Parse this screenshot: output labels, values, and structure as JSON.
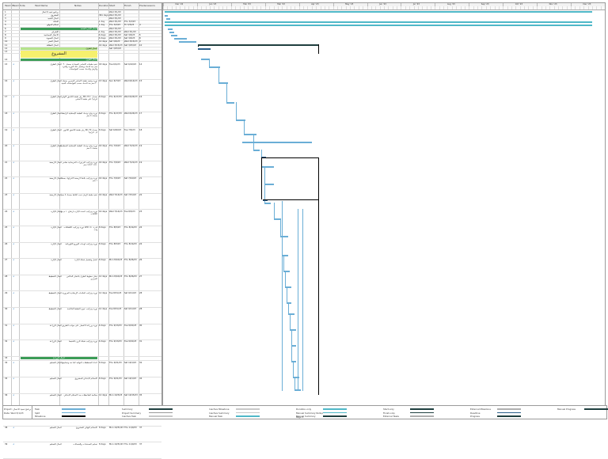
{
  "columns": {
    "num": "Task ID",
    "mode": "Task Mode",
    "name": "Task Name",
    "notes": "Notes",
    "duration": "Duration",
    "start": "Start",
    "finish": "Finish",
    "pred": "Predecessors"
  },
  "timeline": {
    "months": [
      "Dec '22",
      "Jan '23",
      "Feb '23",
      "Mar '23",
      "Apr '23",
      "May '23",
      "Jun '23",
      "Jul '23",
      "Aug '23",
      "Sep '23",
      "Oct '23",
      "Nov '23",
      "Dec '23"
    ]
  },
  "rows": [
    {
      "id": "1",
      "mode": "",
      "name": "برنامج تنفيذ الاعمال",
      "dur": "",
      "start": "Wed 3/1/23",
      "finish": "",
      "pred": "",
      "style": "plain"
    },
    {
      "id": "2",
      "mode": "",
      "name": "المشروع",
      "dur": "361 days",
      "start": "Wed 3/1/23",
      "finish": "",
      "pred": "",
      "style": "plain"
    },
    {
      "id": "3",
      "mode": "",
      "name": "اعمال التنفيذ",
      "dur": "",
      "start": "Wed 3/1/23",
      "finish": "",
      "pred": "",
      "style": "plain"
    },
    {
      "id": "4",
      "mode": "",
      "name": "التعاقد",
      "dur": "1 day",
      "start": "Wed 3/1/23",
      "finish": "Thu 3/2/23",
      "pred": "",
      "style": "plain"
    },
    {
      "id": "5",
      "mode": "",
      "name": "استلام الموقع",
      "dur": "1 day",
      "start": "Thu 3/2/23",
      "finish": "Fri 3/3/23",
      "pred": "4",
      "style": "plain"
    },
    {
      "id": "6",
      "mode": "",
      "name": "أعمال الإدارة العامة",
      "dur": "",
      "start": "Wed 3/1/23",
      "finish": "",
      "pred": "",
      "style": "green"
    },
    {
      "id": "7",
      "mode": "",
      "name": "الإشراف",
      "dur": "1 day",
      "start": "Wed 3/1/23",
      "finish": "Wed 3/1/23",
      "pred": "",
      "style": "plain"
    },
    {
      "id": "8",
      "mode": "",
      "name": "الاعمال المساحية",
      "dur": "6 days",
      "start": "Wed 3/1/23",
      "finish": "Sat 3/4/23",
      "pred": "5",
      "style": "plain"
    },
    {
      "id": "9",
      "mode": "",
      "name": "أعمال التسوية",
      "dur": "6 days",
      "start": "Wed 3/1/23",
      "finish": "Sat 3/4/23",
      "pred": "8",
      "style": "plain"
    },
    {
      "id": "10",
      "mode": "",
      "name": "أعمال الحفر",
      "dur": "10 days",
      "start": "Sat 3/4/23",
      "finish": "Wed 3/15/23",
      "pred": "9",
      "style": "plain"
    },
    {
      "id": "11",
      "mode": "",
      "name": "اعمال النظافة",
      "dur": "16 days",
      "start": "Wed 3/15/23",
      "finish": "Sat 3/25/23",
      "pred": "10",
      "style": "plain"
    },
    {
      "id": "12",
      "mode": "",
      "name": "اعمال الطرق",
      "dur": "",
      "start": "Sat 3/25/23",
      "finish": "",
      "pred": "",
      "style": "lime"
    },
    {
      "id": "13",
      "mode": "",
      "name": "المشروع",
      "dur": "",
      "start": "",
      "finish": "",
      "pred": "",
      "style": "yellow"
    },
    {
      "id": "14",
      "mode": "",
      "name": "اعمال الطرق",
      "dur": "",
      "start": "",
      "finish": "",
      "pred": "",
      "style": "green"
    }
  ],
  "bigrows": [
    {
      "id": "15",
      "mode": "",
      "name": "اعمال الطرق",
      "notes": "تنفيذ طبقات الأساس المساعد بسمك ٣٠ سم بعد الدمك ويشمل ذلك التوريد والفرد والرش والدمك حسب المواصفات",
      "dur": "18 days",
      "start": "Tue 6/1/23",
      "finish": "Sat 6/10/23",
      "pred": "14"
    },
    {
      "id": "16",
      "mode": "",
      "name": "اعمال الطرق",
      "notes": "توريد وتنفيذ طبقة الأساس الحجري بسمك ٢٠ سم بعد الدمك حسب المواصفات الفنية",
      "dur": "13 days",
      "start": "Sun 6/7/23",
      "finish": "Wed 6/14/23",
      "pred": "15"
    },
    {
      "id": "17",
      "mode": "",
      "name": "اعمال الطرق",
      "notes": "رش طبقة اللاصق الأولي MC-70 بمعدل ١ لتر/م٢ على طبقة الأساس",
      "dur": "8 days",
      "start": "Thu 6/17/23",
      "finish": "Wed 6/24/23",
      "pred": "16"
    },
    {
      "id": "18",
      "mode": "",
      "name": "اعمال الطرق",
      "notes": "توريد وفرد ودمك الطبقة الإسفلتية الرابطة بسمك ٥ سم",
      "dur": "8 days",
      "start": "Thu 6/17/23",
      "finish": "Wed 6/24/23",
      "pred": "17"
    },
    {
      "id": "19",
      "mode": "",
      "name": "اعمال الطرق",
      "notes": "رش طبقة اللاصق الثانوي RC-70 بمعدل ٠٫٥ لتر/م٢",
      "dur": "8 days",
      "start": "Sat 6/26/23",
      "finish": "Tue 7/5/23",
      "pred": "18"
    },
    {
      "id": "20",
      "mode": "",
      "name": "اعمال الطرق",
      "notes": "توريد وفرد ودمك الطبقة الإسفلتية السطحية بسمك ٥ سم",
      "dur": "16 days",
      "start": "Thu 7/6/23",
      "finish": "Wed 7/21/23",
      "pred": "19"
    },
    {
      "id": "21",
      "mode": "",
      "name": "اعمال الأرصفة",
      "notes": "توريد وتركيب البردورات الخرسانية مقاس ٥٠×٣٠×١٥ سم",
      "dur": "16 days",
      "start": "Thu 7/6/23",
      "finish": "Wed 7/21/23",
      "pred": "19"
    },
    {
      "id": "22",
      "mode": "",
      "name": "اعمال الأرصفة",
      "notes": "توريد وتركيب بلاط الأرصفة الانترلوك بسمك ٦ سم",
      "dur": "16 days",
      "start": "Thu 7/6/23",
      "finish": "Sat 7/24/23",
      "pred": "21"
    },
    {
      "id": "23",
      "mode": "",
      "name": "اعمال الأرصفة",
      "notes": "تنفيذ طبقة الرمل تحت البلاط بسمك ٥ سم",
      "dur": "16 days",
      "start": "Wed 7/14/23",
      "finish": "Sat 7/31/23",
      "pred": "22"
    },
    {
      "id": "24",
      "mode": "",
      "name": "اعمال الإنارة",
      "notes": "توريد وتركيب أعمدة الإنارة بارتفاع ١٠ م مع الكابلات",
      "dur": "16 days",
      "start": "Wed 7/14/23",
      "finish": "Tue 8/3/23",
      "pred": "23"
    },
    {
      "id": "25",
      "mode": "",
      "name": "اعمال الإنارة",
      "notes": "توريد وتركيب الكشافات LED قدرة ١٥٠ وات",
      "dur": "8 days",
      "start": "Thu 8/5/23",
      "finish": "Thu 8/14/23",
      "pred": "24"
    },
    {
      "id": "26",
      "mode": "",
      "name": "اعمال الإنارة",
      "notes": "توريد وتركيب لوحات التوزيع الكهربائية",
      "dur": "8 days",
      "start": "Thu 8/5/23",
      "finish": "Thu 8/14/23",
      "pred": "24"
    },
    {
      "id": "27",
      "mode": "",
      "name": "اعمال الإنارة",
      "notes": "اختبار وتشغيل شبكة الإنارة",
      "dur": "8 days",
      "start": "Mon 8/16/23",
      "finish": "Thu 8/26/23",
      "pred": "26"
    },
    {
      "id": "28",
      "mode": "",
      "name": "اعمال التخطيط",
      "notes": "دهان خطوط الطرق بالدهان العاكس الحراري",
      "dur": "12 days",
      "start": "Mon 8/16/23",
      "finish": "Thu 8/26/23",
      "pred": "27"
    },
    {
      "id": "29",
      "mode": "",
      "name": "اعمال التخطيط",
      "notes": "توريد وتركيب العلامات الإرشادية المرورية",
      "dur": "12 days",
      "start": "Tue 8/31/23",
      "finish": "Sat 9/11/23",
      "pred": "28"
    },
    {
      "id": "30",
      "mode": "",
      "name": "اعمال التخطيط",
      "notes": "توريد وتركيب عيون القطط العاكسة",
      "dur": "12 days",
      "start": "Tue 8/31/23",
      "finish": "Sat 9/11/23",
      "pred": "28"
    },
    {
      "id": "31",
      "mode": "",
      "name": "اعمال الزراعة",
      "notes": "توريد وزراعة الأشجار على جوانب الطريق",
      "dur": "6 days",
      "start": "Thu 9/13/23",
      "finish": "Tue 9/19/23",
      "pred": "30"
    },
    {
      "id": "32",
      "mode": "",
      "name": "اعمال الزراعة",
      "notes": "توريد وتركيب شبكة الري بالتنقيط",
      "dur": "6 days",
      "start": "Thu 9/13/23",
      "finish": "Tue 9/19/23",
      "pred": "31"
    },
    {
      "id": "33",
      "mode": "",
      "name": "اعمال الزراعة",
      "notes": "",
      "dur": "",
      "start": "",
      "finish": "",
      "pred": "",
      "green": true
    },
    {
      "id": "34",
      "mode": "",
      "name": "اعمال التسليم",
      "notes": "اعداد المخططات النهائية كما نفذ وتسليمها",
      "dur": "8 days",
      "start": "Thu 9/21/23",
      "finish": "Sat 10/1/23",
      "pred": "32"
    },
    {
      "id": "35",
      "mode": "",
      "name": "اعمال التسليم",
      "notes": "الاستلام الابتدائي للمشروع",
      "dur": "8 days",
      "start": "Thu 9/21/23",
      "finish": "Sat 10/1/23",
      "pred": "34"
    },
    {
      "id": "36",
      "mode": "",
      "name": "اعمال التسليم",
      "notes": "معالجة الملاحظات بعد الاستلام الابتدائي",
      "dur": "12 days",
      "start": "Mon 10/3/23",
      "finish": "Sat 10/15/23",
      "pred": "35"
    },
    {
      "id": "37",
      "mode": "",
      "name": "اعمال التسليم",
      "notes": "فترة الصيانة والضمان",
      "dur": "12 days",
      "start": "Mon 10/17/23",
      "finish": "Sat 10/29/23",
      "pred": "36"
    },
    {
      "id": "38",
      "mode": "",
      "name": "اعمال التسليم",
      "notes": "الاستلام النهائي للمشروع",
      "dur": "8 days",
      "start": "Mon 10/31/23",
      "finish": "Thu 11/9/23",
      "pred": "37"
    },
    {
      "id": "39",
      "mode": "",
      "name": "اعمال التسليم",
      "notes": "تسليم المستندات والضمانات",
      "dur": "8 days",
      "start": "Mon 10/31/23",
      "finish": "Thu 11/9/23",
      "pred": "37"
    }
  ],
  "legend": {
    "project_label": "Project: برنامج تنفيذ الاعمال",
    "date_label": "Date: Wed 3/1/23",
    "items": [
      {
        "label": "Task",
        "color": "#6aaed6"
      },
      {
        "label": "Split",
        "color": "#6aaed6"
      },
      {
        "label": "Milestone",
        "color": "#000000"
      },
      {
        "label": "Summary",
        "color": "#1f3f3f"
      },
      {
        "label": "Project Summary",
        "color": "#9a9a9a"
      },
      {
        "label": "Inactive Task",
        "color": "#c9c9c9"
      },
      {
        "label": "Inactive Milestone",
        "color": "#c9c9c9"
      },
      {
        "label": "Inactive Summary",
        "color": "#c9c9c9"
      },
      {
        "label": "Manual Task",
        "color": "#4fb8c8"
      },
      {
        "label": "Duration-only",
        "color": "#4fb8c8"
      },
      {
        "label": "Manual Summary Rollup",
        "color": "#4fb8c8"
      },
      {
        "label": "Manual Summary",
        "color": "#1f3f3f"
      },
      {
        "label": "Start-only",
        "color": "#1f3f3f"
      },
      {
        "label": "Finish-only",
        "color": "#1f3f3f"
      },
      {
        "label": "External Tasks",
        "color": "#b0b0b0"
      },
      {
        "label": "External Milestone",
        "color": "#b0b0b0"
      },
      {
        "label": "Deadline",
        "color": "#2c5f8a"
      },
      {
        "label": "Progress",
        "color": "#1f3f3f"
      },
      {
        "label": "Manual Progress",
        "color": "#1f3f3f"
      }
    ],
    "page": "Page 1"
  },
  "colors": {
    "task": "#6aaed6",
    "summary": "#1f3f3f",
    "manual": "#4fb8c8",
    "green": "#3b9c57",
    "yellow": "#f6f06d"
  }
}
